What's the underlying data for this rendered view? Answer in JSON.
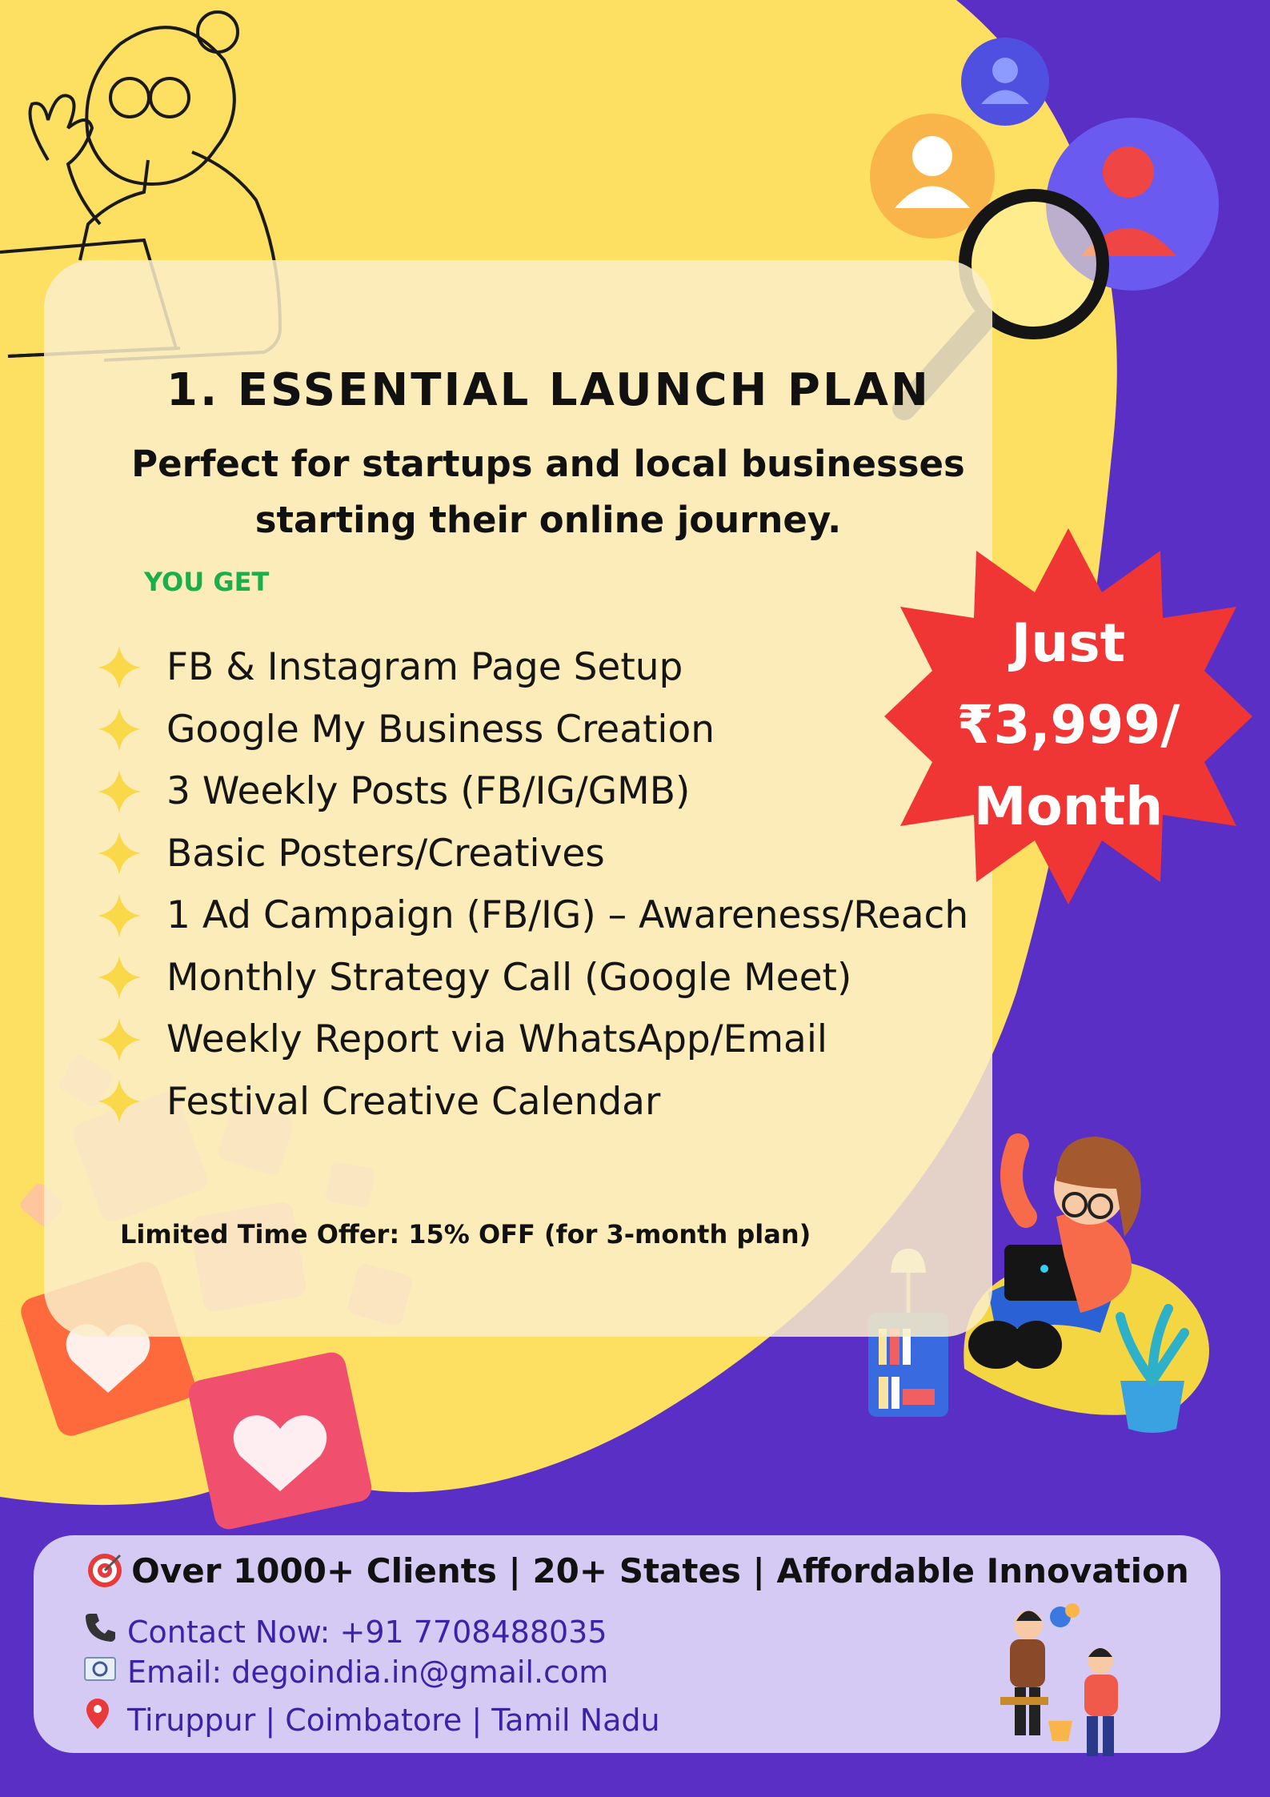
{
  "poster": {
    "title": "1. ESSENTIAL LAUNCH PLAN",
    "subtitle_line1": "Perfect for startups and local businesses",
    "subtitle_line2": "starting their online journey.",
    "section_label": "YOU GET",
    "features": [
      "FB & Instagram Page Setup",
      "Google My Business Creation",
      "3 Weekly Posts (FB/IG/GMB)",
      "Basic Posters/Creatives",
      "1 Ad Campaign (FB/IG) – Awareness/Reach",
      "Monthly Strategy Call (Google Meet)",
      "Weekly Report via WhatsApp/Email",
      "Festival Creative Calendar"
    ],
    "offer": "Limited Time Offer: 15% OFF (for 3-month plan)",
    "price_badge": {
      "line1": "Just",
      "line2": "₹3,999/",
      "line3": "Month"
    }
  },
  "footer": {
    "tagline": "Over 1000+ Clients | 20+ States | Affordable Innovation",
    "contact": "Contact Now: +91 7708488035",
    "email": "Email: degoindia.in@gmail.com",
    "location": "Tiruppur | Coimbatore | Tamil Nadu"
  },
  "icons": {
    "tagline": "target-icon",
    "contact": "phone-icon",
    "email": "email-icon",
    "location": "pin-icon",
    "feature_bullet": "sparkle-icon"
  },
  "colors": {
    "yellow": "#fddf62",
    "purple": "#5a2fc6",
    "card": "#faeec8",
    "badge_red": "#f03535",
    "you_get_green": "#1cae4a",
    "footer_text": "#3b23a8"
  }
}
